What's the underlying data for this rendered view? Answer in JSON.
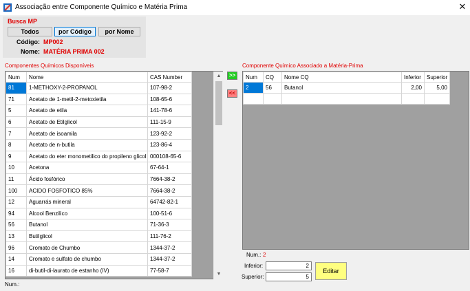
{
  "window": {
    "title": "Associação entre Componente Químico e Matéria Prima"
  },
  "busca": {
    "title": "Busca MP",
    "buttons": {
      "todos": "Todos",
      "por_codigo": "por Código",
      "por_nome": "por Nome"
    },
    "codigo_label": "Código:",
    "codigo_value": "MP002",
    "nome_label": "Nome:",
    "nome_value": "MATÉRIA PRIMA 002"
  },
  "disponiveis": {
    "title": "Componentes Químicos Disponíveis",
    "columns": [
      "Num",
      "Nome",
      "CAS Number"
    ],
    "rows": [
      [
        "81",
        "1-METHOXY-2-PROPANOL",
        "107-98-2"
      ],
      [
        "71",
        "Acetato de 1-metil-2-metoxietila",
        "108-65-6"
      ],
      [
        "5",
        "Acetato de etila",
        "141-78-6"
      ],
      [
        "6",
        "Acetato de Etilglicol",
        "111-15-9"
      ],
      [
        "7",
        "Acetato de isoamila",
        "123-92-2"
      ],
      [
        "8",
        "Acetato de n-butila",
        "123-86-4"
      ],
      [
        "9",
        "Acetato do eter monometilico do propileno glicol",
        "000108-65-6"
      ],
      [
        "10",
        "Acetona",
        "67-64-1"
      ],
      [
        "11",
        "Ácido fosfórico",
        "7664-38-2"
      ],
      [
        "100",
        "ACIDO FOSFOTICO 85%",
        "7664-38-2"
      ],
      [
        "12",
        "Aguarrás mineral",
        "64742-82-1"
      ],
      [
        "94",
        "Alcool Benzilico",
        "100-51-6"
      ],
      [
        "56",
        "Butanol",
        "71-36-3"
      ],
      [
        "13",
        "Butilglicol",
        "111-76-2"
      ],
      [
        "96",
        "Cromato de Chumbo",
        "1344-37-2"
      ],
      [
        "14",
        "Cromato e sulfato de chumbo",
        "1344-37-2"
      ],
      [
        "16",
        "di-butil-di-laurato de estanho (IV)",
        "77-58-7"
      ]
    ],
    "footer_label": "Num.:"
  },
  "arrows": {
    "add": ">>",
    "remove": "<<"
  },
  "associados": {
    "title": "Componente Químico Associado a Matéria-Prima",
    "columns": [
      "Num",
      "CQ",
      "Nome CQ",
      "Inferior",
      "Superior"
    ],
    "rows": [
      [
        "2",
        "56",
        "Butanol",
        "2,00",
        "5,00"
      ]
    ],
    "num_label": "Num.:",
    "num_value": "2",
    "inferior_label": "Inferior:",
    "inferior_value": "2",
    "superior_label": "Superior:",
    "superior_value": "5",
    "editar_label": "Editar"
  },
  "icons": {
    "app": "app-icon",
    "close": "close-icon",
    "scroll_up": "chevron-up-icon",
    "scroll_down": "chevron-down-icon"
  },
  "colors": {
    "accent_red": "#e00000",
    "selection_blue": "#0078d7",
    "add_green": "#22cc22",
    "remove_red": "#ff8080",
    "editar_yellow": "#ffff80"
  }
}
